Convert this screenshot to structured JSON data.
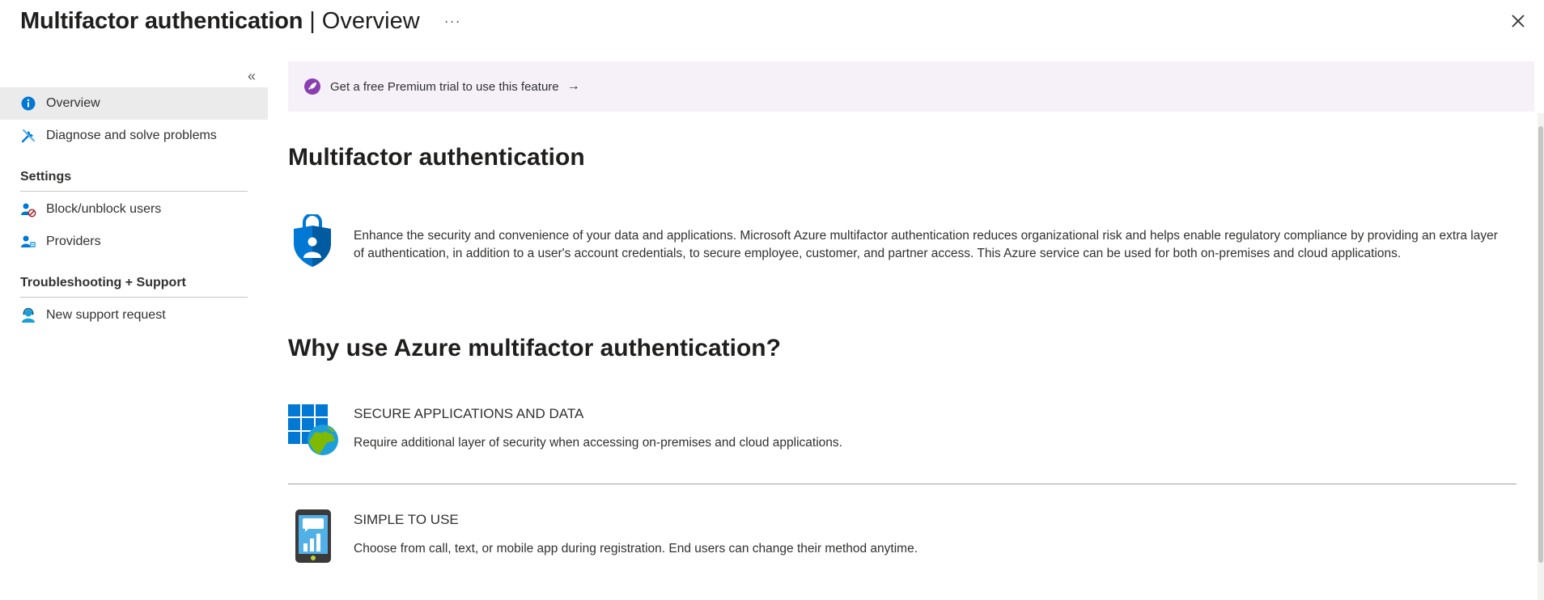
{
  "header": {
    "title": "Multifactor authentication",
    "separator": "|",
    "subtitle": "Overview",
    "more_label": "···",
    "close_icon": "close-icon"
  },
  "sidebar": {
    "collapse_label": "«",
    "items": [
      {
        "label": "Overview",
        "icon": "info-icon",
        "active": true
      },
      {
        "label": "Diagnose and solve problems",
        "icon": "wrench-icon",
        "active": false
      }
    ],
    "sections": [
      {
        "title": "Settings",
        "items": [
          {
            "label": "Block/unblock users",
            "icon": "user-block-icon"
          },
          {
            "label": "Providers",
            "icon": "providers-icon"
          }
        ]
      },
      {
        "title": "Troubleshooting + Support",
        "items": [
          {
            "label": "New support request",
            "icon": "support-person-icon"
          }
        ]
      }
    ]
  },
  "banner": {
    "text": "Get a free Premium trial to use this feature",
    "arrow": "→",
    "icon": "rocket-icon"
  },
  "main": {
    "heading": "Multifactor authentication",
    "description": "Enhance the security and convenience of your data and applications. Microsoft Azure multifactor authentication reduces organizational risk and helps enable regulatory compliance by providing an extra layer of authentication, in addition to a user's account credentials, to secure employee, customer, and partner access. This Azure service can be used for both on-premises and cloud applications.",
    "why_heading": "Why use Azure multifactor authentication?",
    "features": [
      {
        "title": "SECURE APPLICATIONS AND DATA",
        "description": "Require additional layer of security when accessing on-premises and cloud applications.",
        "icon": "apps-globe-icon"
      },
      {
        "title": "SIMPLE TO USE",
        "description": "Choose from call, text, or mobile app during registration. End users can change their method anytime.",
        "icon": "mobile-phone-icon"
      }
    ]
  },
  "colors": {
    "accent": "#0078d4",
    "banner_bg": "#f6f1f9",
    "banner_icon": "#8a3fb0",
    "active_nav_bg": "#ebebeb"
  }
}
